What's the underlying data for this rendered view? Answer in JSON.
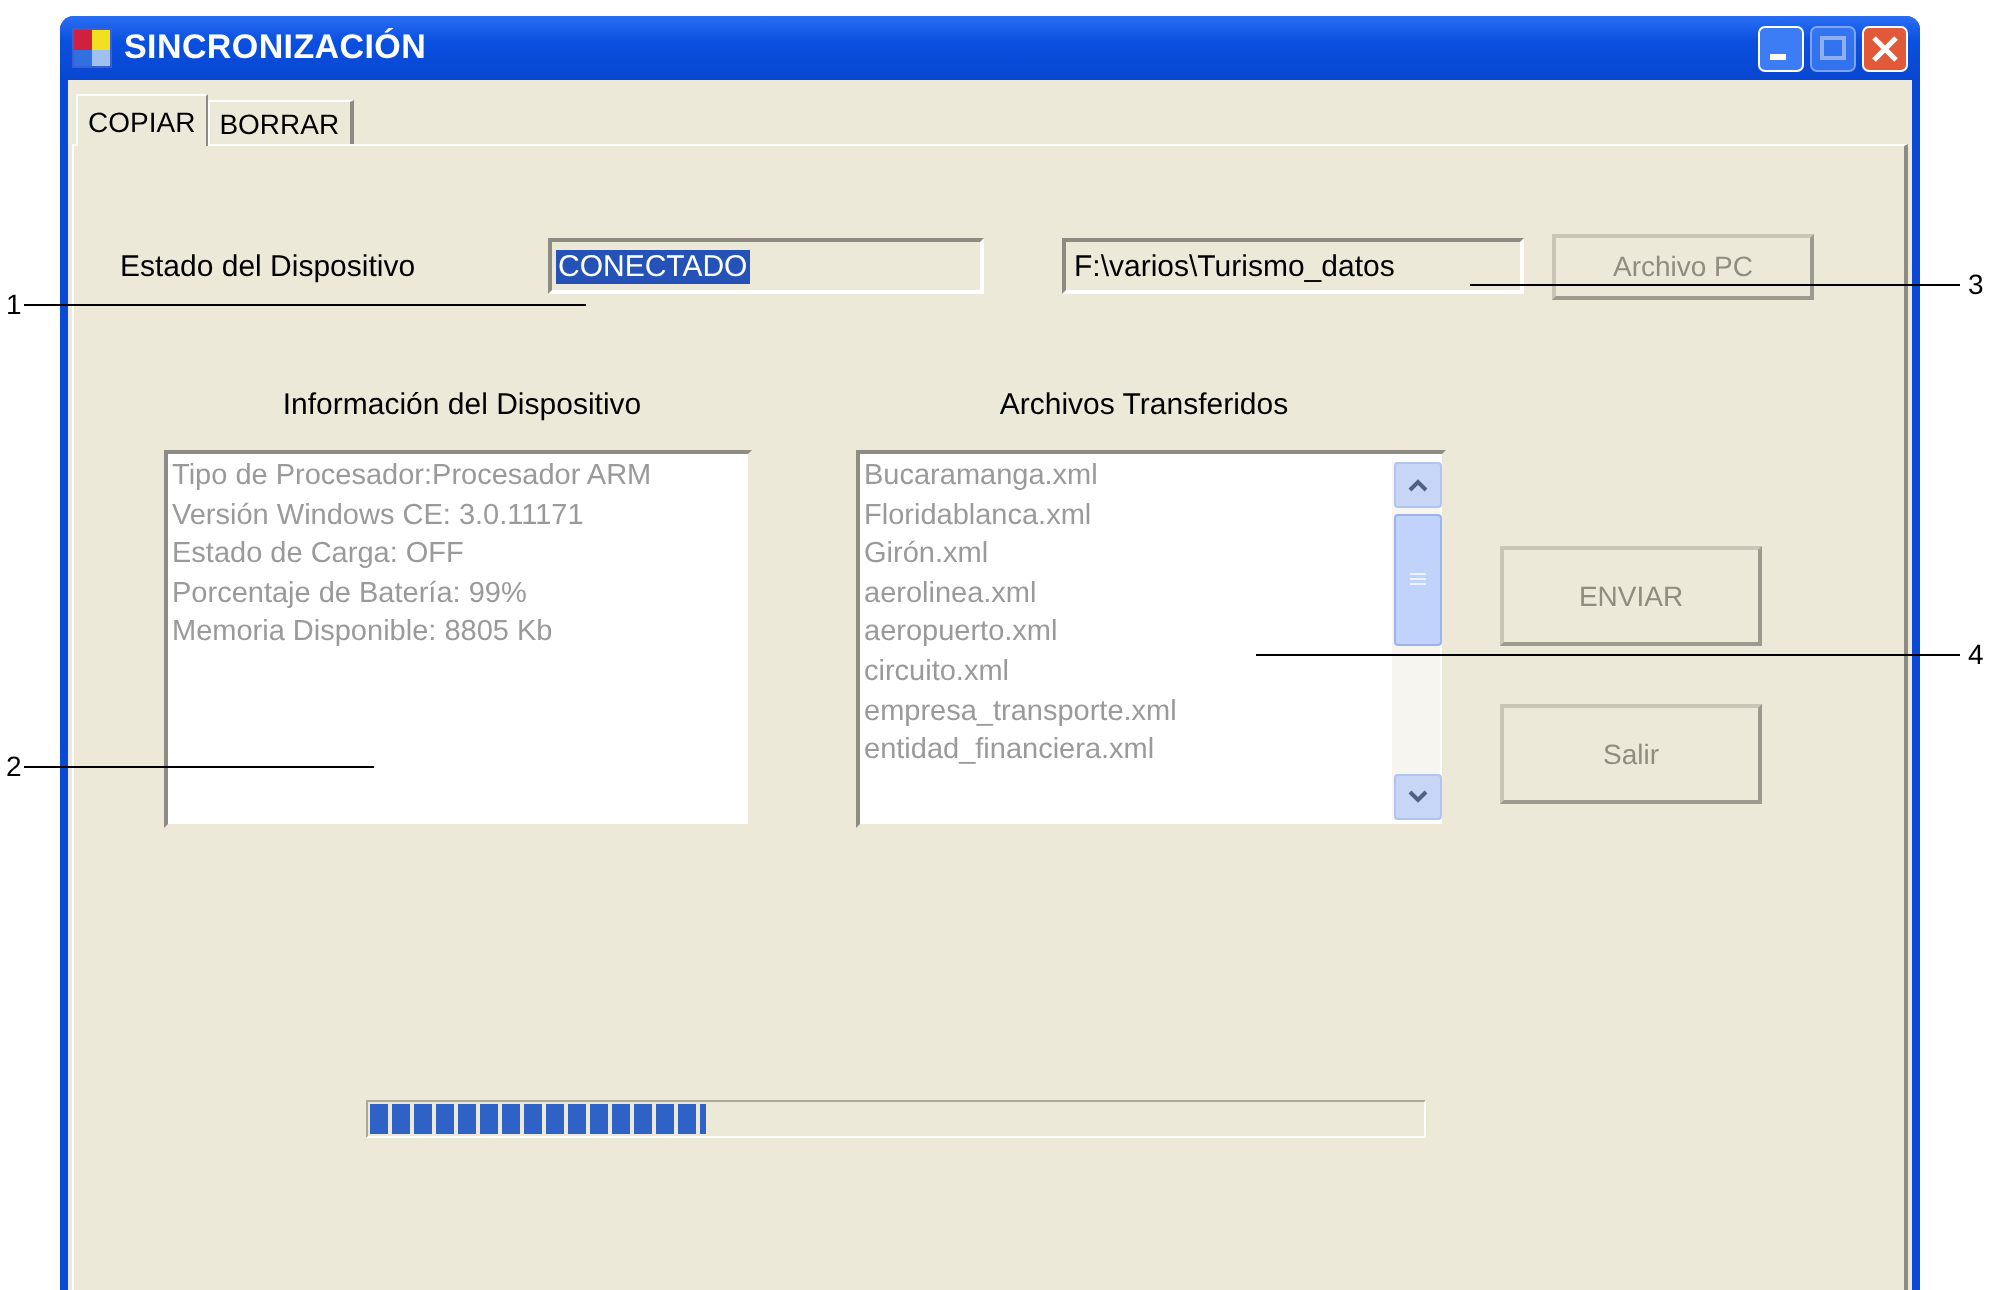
{
  "window": {
    "title": "SINCRONIZACIÓN"
  },
  "tabs": [
    {
      "label": "COPIAR",
      "selected": true
    },
    {
      "label": "BORRAR",
      "selected": false
    }
  ],
  "device_status": {
    "label": "Estado del Dispositivo",
    "value": "CONECTADO",
    "text_selected": true
  },
  "path_field": {
    "value": "F:\\varios\\Turismo_datos"
  },
  "archivo_pc_button": {
    "label": "Archivo PC",
    "disabled": true
  },
  "device_info": {
    "title": "Información del Dispositivo",
    "lines": [
      "Tipo de Procesador:Procesador ARM",
      "Versión Windows CE: 3.0.11171",
      "Estado de Carga: OFF",
      "Porcentaje de Batería: 99%",
      "Memoria Disponible: 8805 Kb"
    ]
  },
  "transferred_files": {
    "title": "Archivos Transferidos",
    "items": [
      "Bucaramanga.xml",
      "Floridablanca.xml",
      "Girón.xml",
      "aerolinea.xml",
      "aeropuerto.xml",
      "circuito.xml",
      "empresa_transporte.xml",
      "entidad_financiera.xml"
    ]
  },
  "buttons": [
    {
      "label": "ENVIAR",
      "disabled": true
    },
    {
      "label": "Salir",
      "disabled": true
    }
  ],
  "progress": {
    "level": 0.32
  },
  "callouts": [
    {
      "label": "1"
    },
    {
      "label": "2"
    },
    {
      "label": "3"
    },
    {
      "label": "4"
    }
  ]
}
